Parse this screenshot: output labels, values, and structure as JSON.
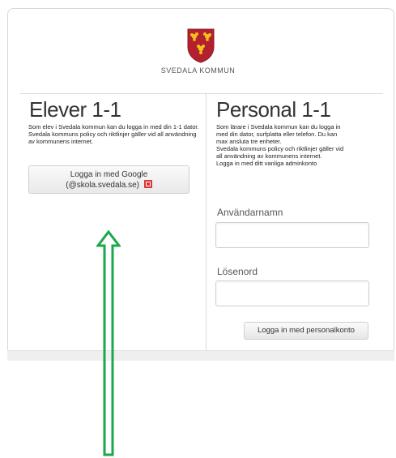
{
  "header": {
    "brand_text": "SVEDALA KOMMUN",
    "logo_icon": "svedala-coat-of-arms"
  },
  "students": {
    "title": "Elever 1-1",
    "description": "Som elev i Svedala kommun kan du logga in med din 1-1 dator. Svedala kommuns policy och riktlinjer gäller vid all användning av kommunens internet.",
    "google_button_line1": "Logga in med Google",
    "google_button_line2": "(@skola.svedala.se)",
    "google_icon": "google-plus-icon"
  },
  "staff": {
    "title": "Personal 1-1",
    "description_lines": [
      "Som lärare i Svedala kommun kan du logga in",
      "med din dator, surfplatta eller telefon. Du kan",
      "max ansluta tre enheter.",
      "Svedala kommuns policy och riktlinjer gäller vid",
      "all användning av kommunens internet.",
      "Logga in med ditt vanliga adminkonto"
    ],
    "username_label": "Användarnamn",
    "username_value": "",
    "password_label": "Lösenord",
    "password_value": "",
    "login_button": "Logga in med personalkonto"
  },
  "annotation": {
    "arrow_color": "#1aa84a",
    "arrow_icon": "up-arrow-annotation"
  },
  "colors": {
    "shield_red": "#b3202e",
    "shield_gold": "#f2c21b"
  }
}
